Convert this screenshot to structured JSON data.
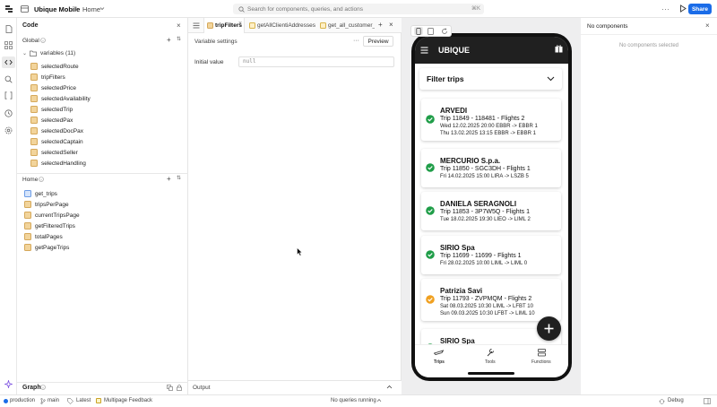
{
  "header": {
    "app_name": "Ubique Mobile",
    "separator": "/",
    "page": "Home",
    "search_placeholder": "Search for components, queries, and actions",
    "search_shortcut": "⌘K",
    "more_label": "···",
    "share_label": "Share"
  },
  "code_panel": {
    "title": "Code",
    "global_label": "Global",
    "variables_label": "variables",
    "variables_count": "(11)",
    "variables": [
      "selectedRoute",
      "tripFilters",
      "selectedPrice",
      "selectedAvailability",
      "selectedTrip",
      "selectedPax",
      "selectedDocPax",
      "selectedCaptain",
      "selectedSeller",
      "selectedHandling"
    ],
    "home_label": "Home",
    "home_items": [
      "get_trips",
      "tripsPerPage",
      "currentTripsPage",
      "getFilteredTrips",
      "totalPages",
      "getPageTrips"
    ],
    "graph_label": "Graph"
  },
  "editor": {
    "tabs": [
      "tripFilters",
      "getAllClientiAddresses",
      "get_all_customer_"
    ],
    "variable_settings": "Variable settings",
    "preview_label": "Preview",
    "dots_label": "···",
    "initial_value_label": "Initial value",
    "initial_value": "null",
    "output_label": "Output"
  },
  "app_preview": {
    "title": "UBIQUE",
    "filter_label": "Filter trips",
    "trips": [
      {
        "name": "ARVEDI",
        "line1": "Trip 11849 - 118481 - Flights 2",
        "line2": "Wed 12.02.2025 20:00 EBBR -> EBBR 1",
        "line3": "Thu 13.02.2025 13:15 EBBR -> EBBR 1",
        "status": "done"
      },
      {
        "name": "MERCURIO S.p.a.",
        "line1": "Trip 11850 - SGC3DH - Flights 1",
        "line2": "Fri 14.02.2025 15:00 LIRA -> LSZB 5",
        "line3": "",
        "status": "done"
      },
      {
        "name": "DANIELA SERAGNOLI",
        "line1": "Trip 11853 - 3P7W5Q - Flights 1",
        "line2": "Tue 18.02.2025 19:30 LIEO -> LIML 2",
        "line3": "",
        "status": "done"
      },
      {
        "name": "SIRIO Spa",
        "line1": "Trip 11699 - 11699 - Flights 1",
        "line2": "Fri 28.02.2025 10:00 LIML -> LIML 0",
        "line3": "",
        "status": "done"
      },
      {
        "name": "Patrizia Savi",
        "line1": "Trip 11793 - ZVPMQM - Flights 2",
        "line2": "Sat 08.03.2025 10:30 LIML -> LFBT 10",
        "line3": "Sun 09.03.2025 10:30 LFBT -> LIML 10",
        "status": "pending"
      },
      {
        "name": "SIRIO Spa",
        "line1": "",
        "line2": "",
        "line3": "",
        "status": "done"
      }
    ],
    "nav": [
      "Trips",
      "Tools",
      "Functions"
    ]
  },
  "right_panel": {
    "title": "No components",
    "subtitle": "No components selected"
  },
  "status_bar": {
    "env": "production",
    "branch": "main",
    "version": "Latest",
    "feedback": "Multipage Feedback",
    "queries": "No queries running",
    "debug": "Debug"
  },
  "colors": {
    "accent": "#1a6ce8",
    "done": "#1f9d48",
    "pending": "#f0a020",
    "app_header": "#202020"
  }
}
